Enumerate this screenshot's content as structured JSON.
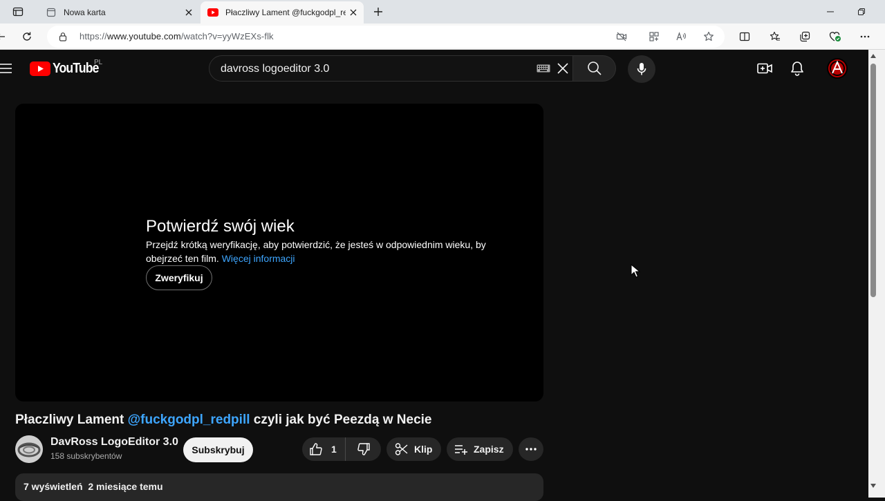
{
  "browser": {
    "tabs": [
      {
        "title": "Nowa karta",
        "active": false,
        "icon": "page-icon"
      },
      {
        "title": "Płaczliwy Lament @fuckgodpl_re",
        "active": true,
        "icon": "youtube-favicon"
      }
    ],
    "url_prefix": "https://",
    "url_host": "www.youtube.com",
    "url_path": "/watch?v=yyWzEXs-flk"
  },
  "youtube": {
    "logo_text": "YouTube",
    "region": "PL",
    "search_value": "davross logoeditor 3.0"
  },
  "age_gate": {
    "title": "Potwierdź swój wiek",
    "text": "Przejdź krótką weryfikację, aby potwierdzić, że jesteś w odpowiednim wieku, by obejrzeć ten film.",
    "link": "Więcej informacji",
    "button": "Zweryfikuj"
  },
  "video": {
    "title_part1": "Płaczliwy Lament",
    "title_mention": "@fuckgodpl_redpill",
    "title_part2": "czyli jak być Peezdą w Necie",
    "channel_name": "DavRoss LogoEditor 3.0",
    "subscribers": "158 subskrybentów",
    "subscribe_label": "Subskrybuj",
    "likes": "1",
    "clip_label": "Klip",
    "save_label": "Zapisz",
    "views": "7 wyświetleń",
    "date": "2 miesiące temu"
  },
  "colors": {
    "accent_link": "#3ea6ff",
    "yt_red": "#ff0000",
    "background": "#0f0f0f"
  }
}
